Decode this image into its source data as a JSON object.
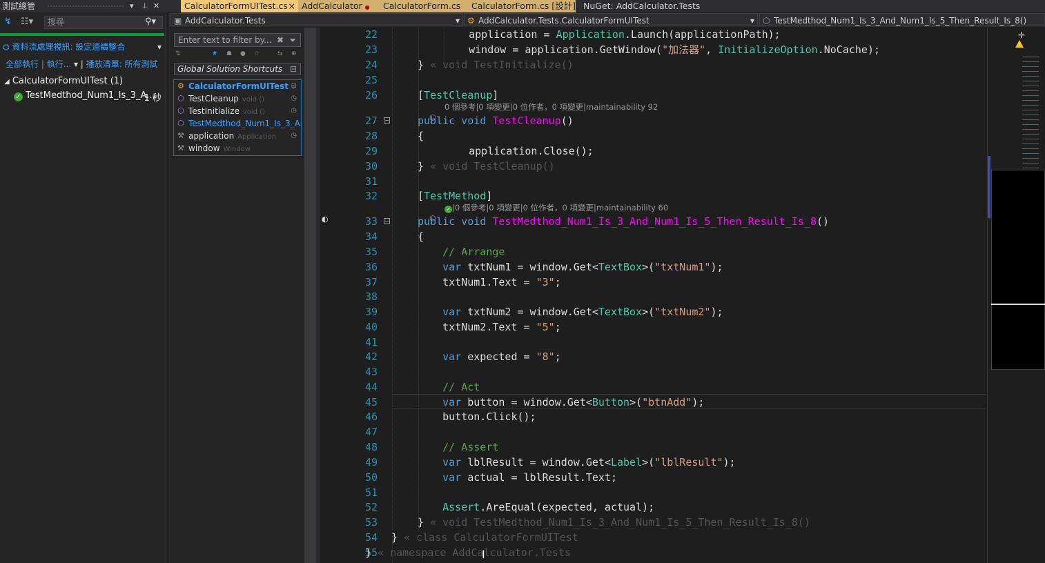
{
  "test_explorer": {
    "title": "測試總管",
    "search_placeholder": "搜尋",
    "playlist_label": "資料流處理視訊: 設定連續整合",
    "run_all": "全部執行",
    "run": "執行...",
    "playlist": "播放清單: 所有測試",
    "group_name": "CalculatorFormUITest (1)",
    "test_name": "TestMedthod_Num1_Is_3_A...",
    "test_duration": "1 秒"
  },
  "tabs": [
    {
      "label": "CalculatorFormUITest.cs",
      "close": "×"
    },
    {
      "label": "AddCalculator",
      "dot": "●"
    },
    {
      "label": "CalculatorForm.cs"
    },
    {
      "label": "CalculatorForm.cs [設計]"
    },
    {
      "label": "NuGet: AddCalculator.Tests"
    }
  ],
  "nav": {
    "project": "AddCalculator.Tests",
    "type": "AddCalculator.Tests.CalculatorFormUITest",
    "member": "TestMedthod_Num1_Is_3_And_Num1_Is_5_Then_Result_Is_8()"
  },
  "structure": {
    "filter_placeholder": "Enter text to filter by...",
    "shortcuts": "Global Solution Shortcuts",
    "members": [
      {
        "name": "CalculatorFormUITest",
        "type": ":"
      },
      {
        "name": "TestCleanup",
        "type": "void ()"
      },
      {
        "name": "TestInitialize",
        "type": "void ()"
      },
      {
        "name": "TestMedthod_Num1_Is_3_And",
        "type": ""
      },
      {
        "name": "application",
        "type": "Application"
      },
      {
        "name": "window",
        "type": "Window"
      }
    ]
  },
  "editor": {
    "lines": [
      {
        "n": "22",
        "html": "    application = <span class=\"ty\">Application</span>.Launch(applicationPath);"
      },
      {
        "n": "23",
        "html": "    window = application.GetWindow(<span class=\"str\">\"加法器\"</span>, <span class=\"ty\">InitializeOption</span>.NoCache);"
      },
      {
        "n": "24",
        "html": "} <span class=\"hint\">« void TestInitialize()</span>"
      },
      {
        "n": "25",
        "html": ""
      },
      {
        "n": "26",
        "html": "[<span class=\"ty\">TestCleanup</span>]"
      },
      {
        "n": "27",
        "html": "<span class=\"kw\">public</span> <span class=\"kw\">void</span> <span class=\"mg\">TestCleanup</span>()"
      },
      {
        "n": "28",
        "html": "{"
      },
      {
        "n": "29",
        "html": "    application.Close();"
      },
      {
        "n": "30",
        "html": "} <span class=\"hint\">« void TestCleanup()</span>"
      },
      {
        "n": "31",
        "html": ""
      },
      {
        "n": "32",
        "html": "[<span class=\"ty\">TestMethod</span>]"
      },
      {
        "n": "33",
        "html": "<span class=\"kw\">public</span> <span class=\"kw\">void</span> <span class=\"mg\">TestMedthod_Num1_Is_3_And_Num1_Is_5_Then_Result_Is_8</span>()"
      },
      {
        "n": "34",
        "html": "{"
      },
      {
        "n": "35",
        "html": "    <span class=\"cm\">// Arrange</span>"
      },
      {
        "n": "36",
        "html": "    <span class=\"kw\">var</span> txtNum1 = window.Get&lt;<span class=\"ty\">TextBox</span>&gt;(<span class=\"str\">\"txtNum1\"</span>);"
      },
      {
        "n": "37",
        "html": "    txtNum1.Text = <span class=\"str\">\"3\"</span>;"
      },
      {
        "n": "38",
        "html": ""
      },
      {
        "n": "39",
        "html": "    <span class=\"kw\">var</span> txtNum2 = window.Get&lt;<span class=\"ty\">TextBox</span>&gt;(<span class=\"str\">\"txtNum2\"</span>);"
      },
      {
        "n": "40",
        "html": "    txtNum2.Text = <span class=\"str\">\"5\"</span>;"
      },
      {
        "n": "41",
        "html": ""
      },
      {
        "n": "42",
        "html": "    <span class=\"kw\">var</span> expected = <span class=\"str\">\"8\"</span>;"
      },
      {
        "n": "43",
        "html": ""
      },
      {
        "n": "44",
        "html": "    <span class=\"cm\">// Act</span>"
      },
      {
        "n": "45",
        "html": "    <span class=\"kw\">var</span> button = window.Get&lt;<span class=\"ty\">Button</span>&gt;(<span class=\"str\">\"btnAdd\"</span>);"
      },
      {
        "n": "46",
        "html": "    button.Click();"
      },
      {
        "n": "47",
        "html": ""
      },
      {
        "n": "48",
        "html": "    <span class=\"cm\">// Assert</span>"
      },
      {
        "n": "49",
        "html": "    <span class=\"kw\">var</span> lblResult = window.Get&lt;<span class=\"ty\">Label</span>&gt;(<span class=\"str\">\"lblResult\"</span>);"
      },
      {
        "n": "50",
        "html": "    <span class=\"kw\">var</span> actual = lblResult.Text;"
      },
      {
        "n": "51",
        "html": ""
      },
      {
        "n": "52",
        "html": "    <span class=\"ty\">Assert</span>.AreEqual(expected, actual);"
      },
      {
        "n": "53",
        "html": "} <span class=\"hint\">« void TestMedthod_Num1_Is_3_And_Num1_Is_5_Then_Result_Is_8()</span>"
      },
      {
        "n": "54",
        "html": "} <span class=\"hint\">« class CalculatorFormUITest</span>"
      },
      {
        "n": "55",
        "html": "} <span class=\"hint\">« namespace AddCalculator.Tests</span>"
      }
    ],
    "codelens_cleanup": "0 個參考|0 項變更|0 位作者，0 項變更|maintainability 92",
    "codelens_method": "|0 個參考|0 項變更|0 位作者，0 項變更|maintainability 60"
  }
}
